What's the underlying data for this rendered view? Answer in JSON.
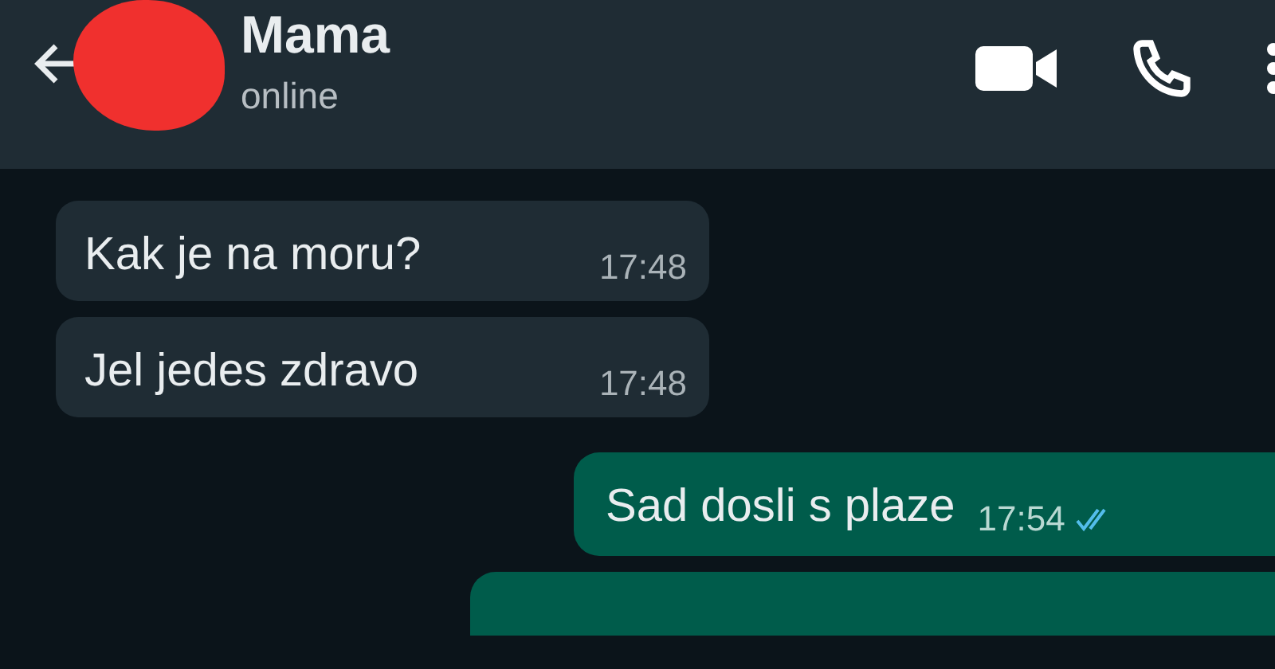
{
  "header": {
    "contact_name": "Mama",
    "status": "online"
  },
  "messages": [
    {
      "kind": "incoming",
      "text": "Kak je na moru?",
      "time": "17:48"
    },
    {
      "kind": "incoming",
      "text": "Jel jedes zdravo",
      "time": "17:48"
    },
    {
      "kind": "outgoing",
      "text": "Sad dosli s plaze",
      "time": "17:54",
      "read": true
    },
    {
      "kind": "partial"
    }
  ]
}
